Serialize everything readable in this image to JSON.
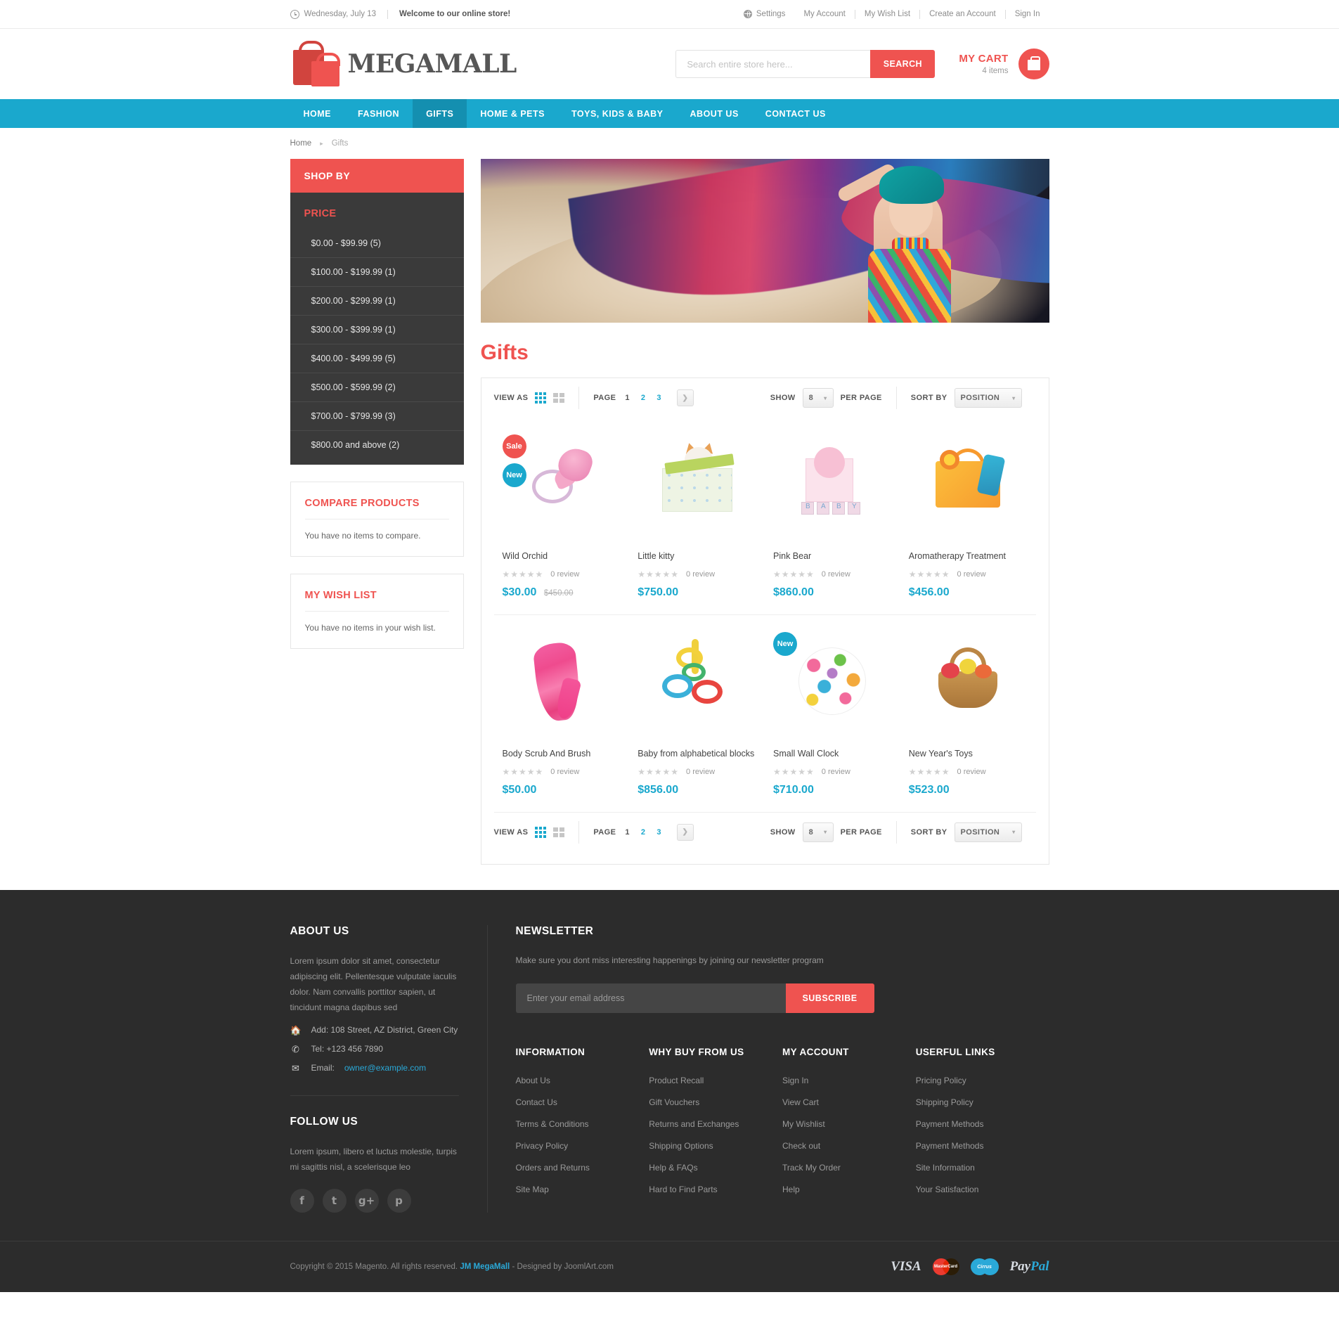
{
  "topbar": {
    "date": "Wednesday, July 13",
    "welcome": "Welcome to our online store!",
    "settings": "Settings",
    "links": [
      "My Account",
      "My Wish List",
      "Create an Account",
      "Sign In"
    ]
  },
  "header": {
    "logo_text": "MEGAMALL",
    "search_placeholder": "Search entire store here...",
    "search_value": "",
    "search_button": "SEARCH",
    "cart_title": "MY CART",
    "cart_items": "4 items"
  },
  "nav": {
    "items": [
      {
        "label": "HOME",
        "active": false
      },
      {
        "label": "FASHION",
        "active": false
      },
      {
        "label": "GIFTS",
        "active": true
      },
      {
        "label": "HOME & PETS",
        "active": false
      },
      {
        "label": "TOYS, KIDS & BABY",
        "active": false
      },
      {
        "label": "ABOUT US",
        "active": false
      },
      {
        "label": "CONTACT US",
        "active": false
      }
    ]
  },
  "breadcrumb": {
    "home": "Home",
    "current": "Gifts",
    "separator": "▸"
  },
  "sidebar": {
    "shop_by": "SHOP BY",
    "price_title": "PRICE",
    "price_items": [
      "$0.00 - $99.99 (5)",
      "$100.00 - $199.99 (1)",
      "$200.00 - $299.99 (1)",
      "$300.00 - $399.99 (1)",
      "$400.00 - $499.99 (5)",
      "$500.00 - $599.99 (2)",
      "$700.00 - $799.99 (3)",
      "$800.00 and above (2)"
    ],
    "compare_title": "COMPARE PRODUCTS",
    "compare_text": "You have no items to compare.",
    "wishlist_title": "MY WISH LIST",
    "wishlist_text": "You have no items in your wish list."
  },
  "main": {
    "page_title": "Gifts",
    "toolbar": {
      "view_as": "VIEW AS",
      "page_label": "PAGE",
      "pages": [
        "1",
        "2",
        "3"
      ],
      "current_page": "1",
      "next_arrow": "❯",
      "show_label": "SHOW",
      "show_value": "8",
      "per_page_label": "PER PAGE",
      "sort_label": "SORT BY",
      "sort_value": "POSITION",
      "caret": "▾"
    },
    "products": [
      {
        "name": "Wild Orchid",
        "price": "$30.00",
        "old_price": "$450.00",
        "reviews": "0 review",
        "stars": "★★★★★",
        "badges": [
          "Sale",
          "New"
        ],
        "art": "a1"
      },
      {
        "name": "Little kitty",
        "price": "$750.00",
        "old_price": "",
        "reviews": "0 review",
        "stars": "★★★★★",
        "badges": [],
        "art": "a2"
      },
      {
        "name": "Pink Bear",
        "price": "$860.00",
        "old_price": "",
        "reviews": "0 review",
        "stars": "★★★★★",
        "badges": [],
        "art": "a3"
      },
      {
        "name": "Aromatherapy Treatment",
        "price": "$456.00",
        "old_price": "",
        "reviews": "0 review",
        "stars": "★★★★★",
        "badges": [],
        "art": "a4"
      },
      {
        "name": "Body Scrub And Brush",
        "price": "$50.00",
        "old_price": "",
        "reviews": "0 review",
        "stars": "★★★★★",
        "badges": [],
        "art": "a5"
      },
      {
        "name": "Baby from alphabetical blocks",
        "price": "$856.00",
        "old_price": "",
        "reviews": "0 review",
        "stars": "★★★★★",
        "badges": [],
        "art": "a6"
      },
      {
        "name": "Small Wall Clock",
        "price": "$710.00",
        "old_price": "",
        "reviews": "0 review",
        "stars": "★★★★★",
        "badges": [
          "New"
        ],
        "art": "a7"
      },
      {
        "name": "New Year's Toys",
        "price": "$523.00",
        "old_price": "",
        "reviews": "0 review",
        "stars": "★★★★★",
        "badges": [],
        "art": "a8"
      }
    ]
  },
  "footer": {
    "about_title": "ABOUT US",
    "about_text": "Lorem ipsum dolor sit amet, consectetur adipiscing elit. Pellentesque vulputate iaculis dolor. Nam convallis porttitor sapien, ut tincidunt magna dapibus sed",
    "address": "Add: 108 Street, AZ District, Green City",
    "tel": "Tel: +123 456 7890",
    "email_label": "Email:",
    "email": "owner@example.com",
    "follow_title": "FOLLOW US",
    "follow_text": "Lorem ipsum, libero et luctus molestie, turpis mi sagittis nisl, a scelerisque leo",
    "socials": [
      "f",
      "t",
      "g+",
      "p"
    ],
    "newsletter_title": "NEWSLETTER",
    "newsletter_text": "Make sure you dont miss interesting happenings by joining our newsletter program",
    "newsletter_placeholder": "Enter your email address",
    "newsletter_value": "",
    "subscribe": "SUBSCRIBE",
    "link_columns": [
      {
        "title": "INFORMATION",
        "links": [
          "About Us",
          "Contact Us",
          "Terms & Conditions",
          "Privacy Policy",
          "Orders and Returns",
          "Site Map"
        ]
      },
      {
        "title": "WHY BUY FROM US",
        "links": [
          "Product Recall",
          "Gift Vouchers",
          "Returns and Exchanges",
          "Shipping Options",
          "Help & FAQs",
          "Hard to Find Parts"
        ]
      },
      {
        "title": "MY ACCOUNT",
        "links": [
          "Sign In",
          "View Cart",
          "My Wishlist",
          "Check out",
          "Track My Order",
          "Help"
        ]
      },
      {
        "title": "USERFUL LINKS",
        "links": [
          "Pricing Policy",
          "Shipping Policy",
          "Payment Methods",
          "Payment Methods",
          "Site Information",
          "Your Satisfaction"
        ]
      }
    ],
    "copyright_pre": "Copyright © 2015 Magento. All rights reserved.",
    "copyright_link": "JM MegaMall",
    "copyright_post": "- Designed by JoomlArt.com",
    "payments": [
      "VISA",
      "MasterCard",
      "Cirrus",
      "PayPal"
    ]
  },
  "colors": {
    "accent_red": "#ef5350",
    "accent_blue": "#1aa8cd",
    "dark": "#2c2c2c",
    "sidebar_dark": "#3a3a3a"
  }
}
